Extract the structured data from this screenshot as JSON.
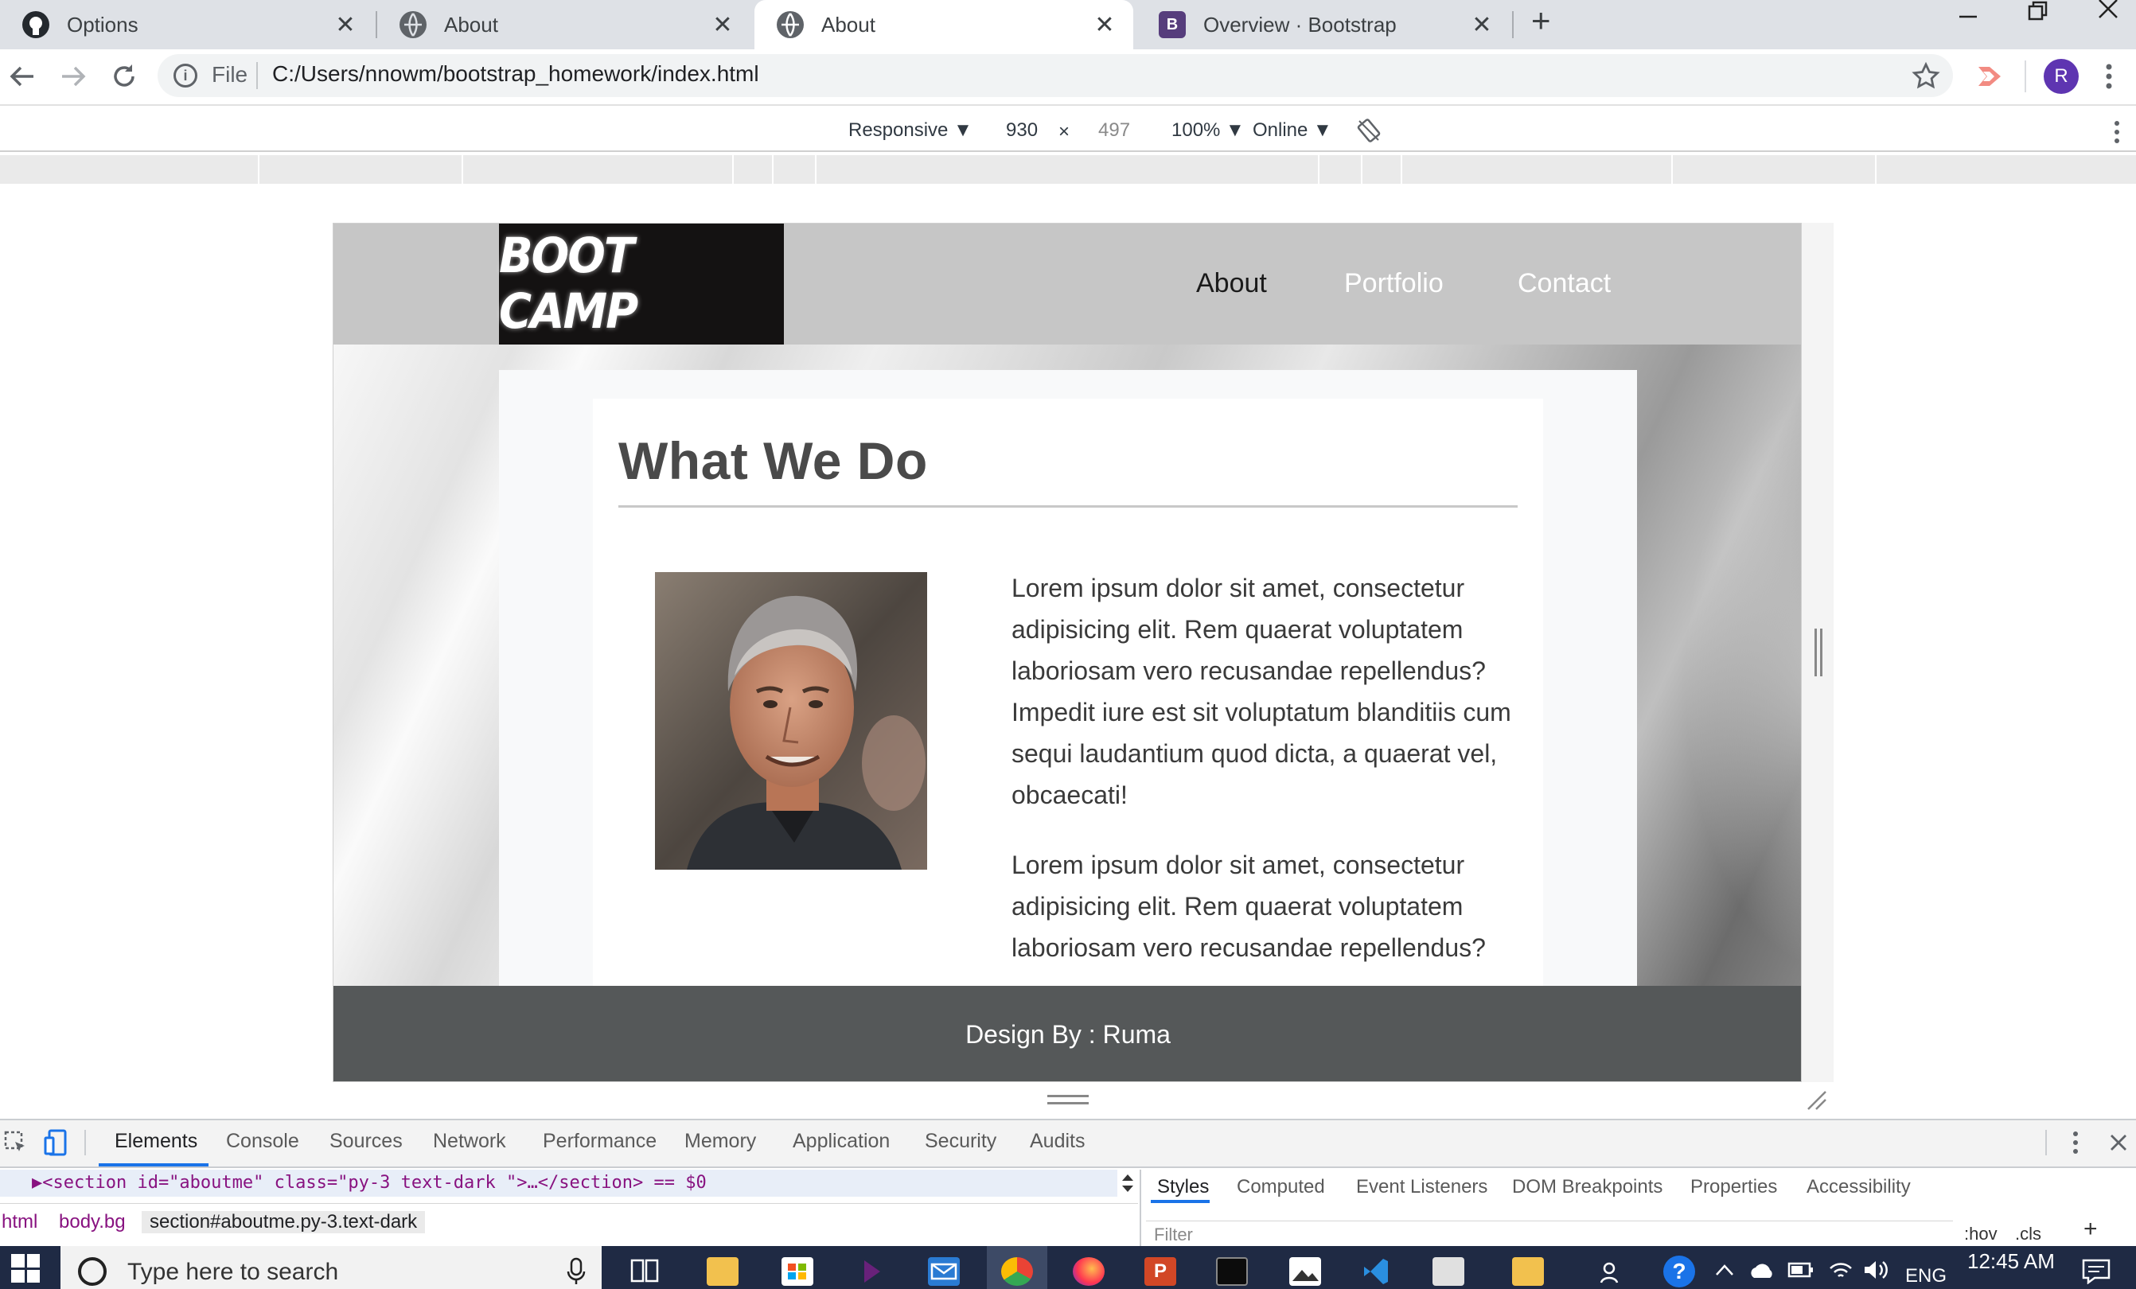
{
  "browser": {
    "tabs": [
      {
        "label": "Options",
        "favicon": "github-icon",
        "active": false
      },
      {
        "label": "About",
        "favicon": "globe-icon",
        "active": false
      },
      {
        "label": "About",
        "favicon": "globe-icon",
        "active": true
      },
      {
        "label": "Overview · Bootstrap",
        "favicon": "bootstrap-icon",
        "active": false
      }
    ],
    "new_tab": "+",
    "address": {
      "scheme": "File",
      "url": "C:/Users/nnowm/bootstrap_homework/index.html"
    },
    "profile_initial": "R"
  },
  "device_toolbar": {
    "mode": "Responsive ▼",
    "width": "930",
    "times": "×",
    "height": "497",
    "zoom": "100% ▼",
    "network": "Online ▼"
  },
  "site": {
    "brand": "BOOT CAMP",
    "nav": [
      {
        "label": "About",
        "active": true
      },
      {
        "label": "Portfolio",
        "active": false
      },
      {
        "label": "Contact",
        "active": false
      }
    ],
    "section_title": "What We Do",
    "paragraphs": [
      "Lorem ipsum dolor sit amet, consectetur adipisicing elit. Rem quaerat voluptatem laboriosam vero recusandae repellendus? Impedit iure est sit voluptatum blanditiis cum sequi laudantium quod dicta, a quaerat vel, obcaecati!",
      "Lorem ipsum dolor sit amet, consectetur adipisicing elit. Rem quaerat voluptatem laboriosam vero recusandae repellendus?"
    ],
    "footer": "Design By : Ruma"
  },
  "devtools": {
    "tabs": [
      "Elements",
      "Console",
      "Sources",
      "Network",
      "Performance",
      "Memory",
      "Application",
      "Security",
      "Audits"
    ],
    "active_tab": "Elements",
    "dom_line": "▶<section id=\"aboutme\" class=\"py-3  text-dark \">…</section> == $0",
    "breadcrumbs": [
      "html",
      "body.bg",
      "section#aboutme.py-3.text-dark"
    ],
    "side_tabs": [
      "Styles",
      "Computed",
      "Event Listeners",
      "DOM Breakpoints",
      "Properties",
      "Accessibility"
    ],
    "filter_placeholder": "Filter",
    "filter_hov": ":hov",
    "filter_cls": ".cls",
    "filter_add": "+"
  },
  "taskbar": {
    "search_placeholder": "Type here to search",
    "language": "ENG",
    "time": "12:45 AM"
  },
  "colors": {
    "nav_bg": "#c6c6c6",
    "brand_bg": "#141212",
    "footer_bg": "#555859",
    "devtools_accent": "#1a73e8",
    "profile": "#5e35b1"
  }
}
